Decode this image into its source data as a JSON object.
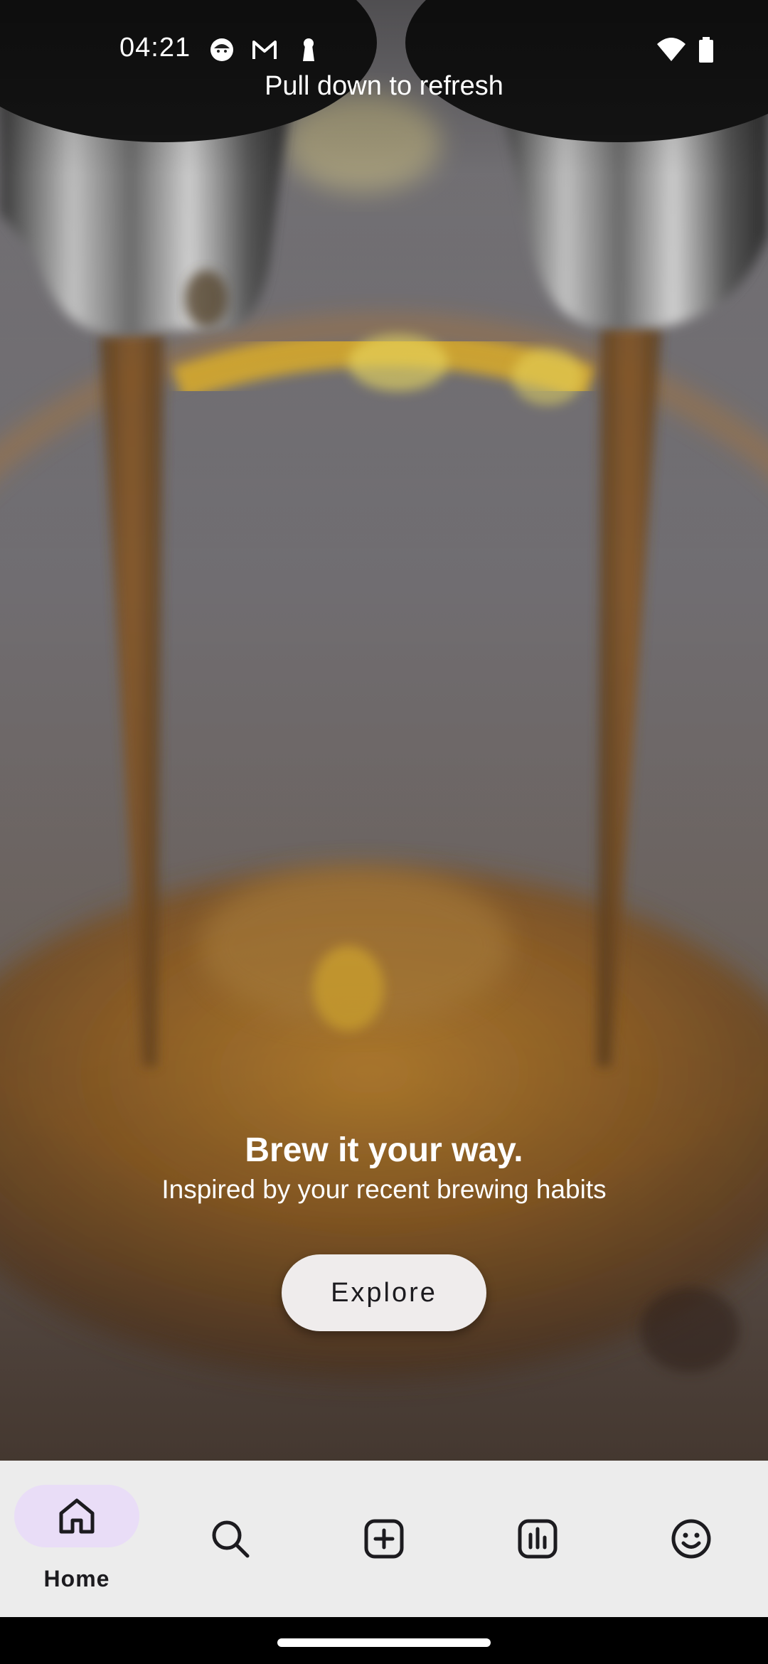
{
  "status_bar": {
    "time": "04:21",
    "left_icons": [
      "emoji-face-icon",
      "gmail-icon",
      "keyhole-icon"
    ],
    "right_icons": [
      "wifi-icon",
      "battery-icon"
    ]
  },
  "refresh_hint": "Pull down to refresh",
  "hero": {
    "image": "espresso-pour-icon",
    "title": "Brew it your way.",
    "subtitle": "Inspired by your recent brewing habits",
    "cta_label": "Explore"
  },
  "bottom_nav": {
    "active_index": 0,
    "items": [
      {
        "icon": "home-icon",
        "label": "Home"
      },
      {
        "icon": "search-icon",
        "label": ""
      },
      {
        "icon": "add-icon",
        "label": ""
      },
      {
        "icon": "stats-icon",
        "label": ""
      },
      {
        "icon": "profile-face-icon",
        "label": ""
      }
    ]
  },
  "colors": {
    "nav_background": "#ececec",
    "active_pill": "#e9ddf7",
    "button_background": "#efecec",
    "text_dark": "#1c1b1f"
  }
}
